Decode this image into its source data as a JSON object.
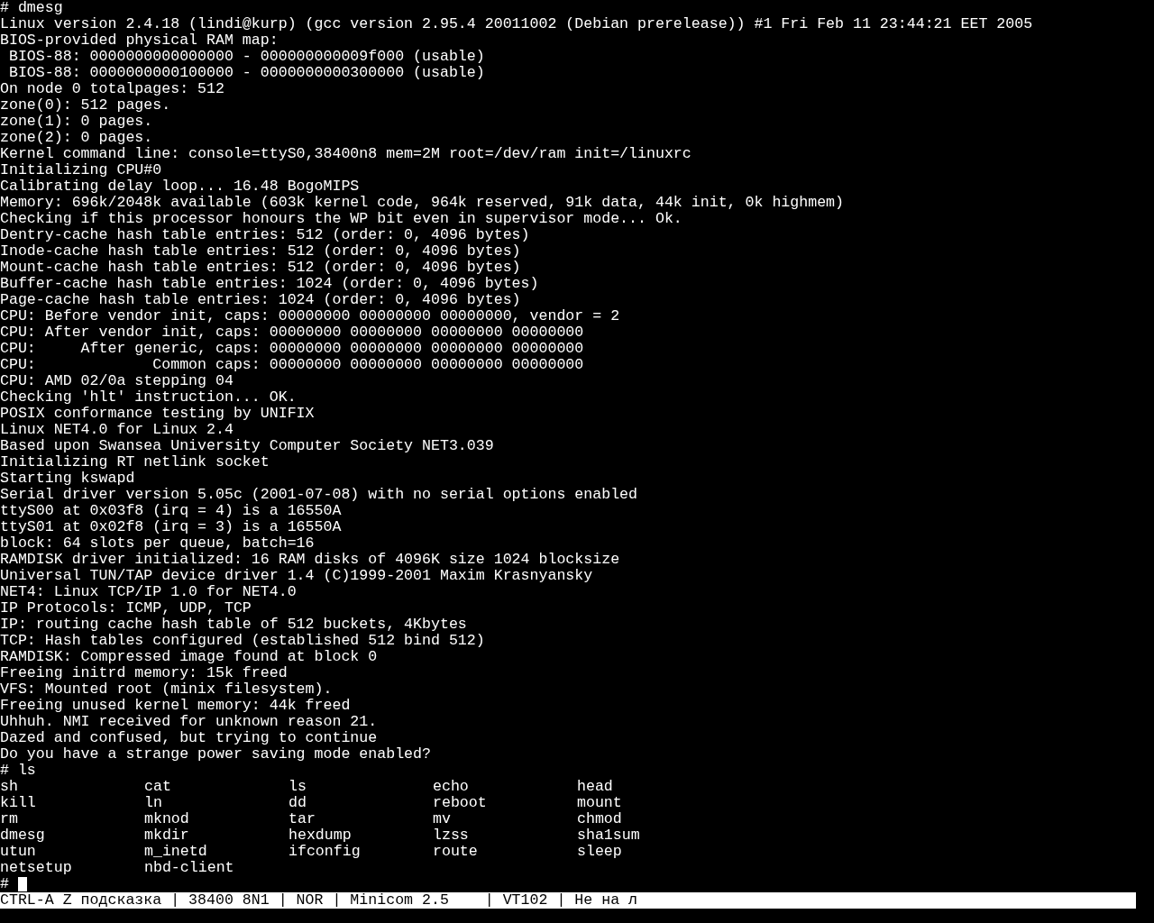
{
  "terminal": {
    "blocks": [
      {
        "command": "# dmesg",
        "output": [
          "Linux version 2.4.18 (lindi@kurp) (gcc version 2.95.4 20011002 (Debian prerelease)) #1 Fri Feb 11 23:44:21 EET 2005",
          "BIOS-provided physical RAM map:",
          " BIOS-88: 0000000000000000 - 000000000009f000 (usable)",
          " BIOS-88: 0000000000100000 - 0000000000300000 (usable)",
          "On node 0 totalpages: 512",
          "zone(0): 512 pages.",
          "zone(1): 0 pages.",
          "zone(2): 0 pages.",
          "Kernel command line: console=ttyS0,38400n8 mem=2M root=/dev/ram init=/linuxrc",
          "Initializing CPU#0",
          "Calibrating delay loop... 16.48 BogoMIPS",
          "Memory: 696k/2048k available (603k kernel code, 964k reserved, 91k data, 44k init, 0k highmem)",
          "Checking if this processor honours the WP bit even in supervisor mode... Ok.",
          "Dentry-cache hash table entries: 512 (order: 0, 4096 bytes)",
          "Inode-cache hash table entries: 512 (order: 0, 4096 bytes)",
          "Mount-cache hash table entries: 512 (order: 0, 4096 bytes)",
          "Buffer-cache hash table entries: 1024 (order: 0, 4096 bytes)",
          "Page-cache hash table entries: 1024 (order: 0, 4096 bytes)",
          "CPU: Before vendor init, caps: 00000000 00000000 00000000, vendor = 2",
          "CPU: After vendor init, caps: 00000000 00000000 00000000 00000000",
          "CPU:     After generic, caps: 00000000 00000000 00000000 00000000",
          "CPU:             Common caps: 00000000 00000000 00000000 00000000",
          "CPU: AMD 02/0a stepping 04",
          "Checking 'hlt' instruction... OK.",
          "POSIX conformance testing by UNIFIX",
          "Linux NET4.0 for Linux 2.4",
          "Based upon Swansea University Computer Society NET3.039",
          "Initializing RT netlink socket",
          "Starting kswapd",
          "Serial driver version 5.05c (2001-07-08) with no serial options enabled",
          "ttyS00 at 0x03f8 (irq = 4) is a 16550A",
          "ttyS01 at 0x02f8 (irq = 3) is a 16550A",
          "block: 64 slots per queue, batch=16",
          "RAMDISK driver initialized: 16 RAM disks of 4096K size 1024 blocksize",
          "Universal TUN/TAP device driver 1.4 (C)1999-2001 Maxim Krasnyansky",
          "NET4: Linux TCP/IP 1.0 for NET4.0",
          "IP Protocols: ICMP, UDP, TCP",
          "IP: routing cache hash table of 512 buckets, 4Kbytes",
          "TCP: Hash tables configured (established 512 bind 512)",
          "RAMDISK: Compressed image found at block 0",
          "Freeing initrd memory: 15k freed",
          "VFS: Mounted root (minix filesystem).",
          "Freeing unused kernel memory: 44k freed",
          "Uhhuh. NMI received for unknown reason 21.",
          "Dazed and confused, but trying to continue",
          "Do you have a strange power saving mode enabled?"
        ]
      },
      {
        "command": "# ls",
        "listing": [
          "sh",
          "cat",
          "ls",
          "echo",
          "head",
          "kill",
          "ln",
          "dd",
          "reboot",
          "mount",
          "rm",
          "mknod",
          "tar",
          "mv",
          "chmod",
          "dmesg",
          "mkdir",
          "hexdump",
          "lzss",
          "sha1sum",
          "utun",
          "m_inetd",
          "ifconfig",
          "route",
          "sleep",
          "netsetup",
          "nbd-client"
        ]
      }
    ],
    "prompt": "#",
    "cursor": true
  },
  "status_bar": {
    "text": "CTRL-A Z подсказка | 38400 8N1 | NOR | Minicom 2.5    | VT102 | Не на л"
  }
}
